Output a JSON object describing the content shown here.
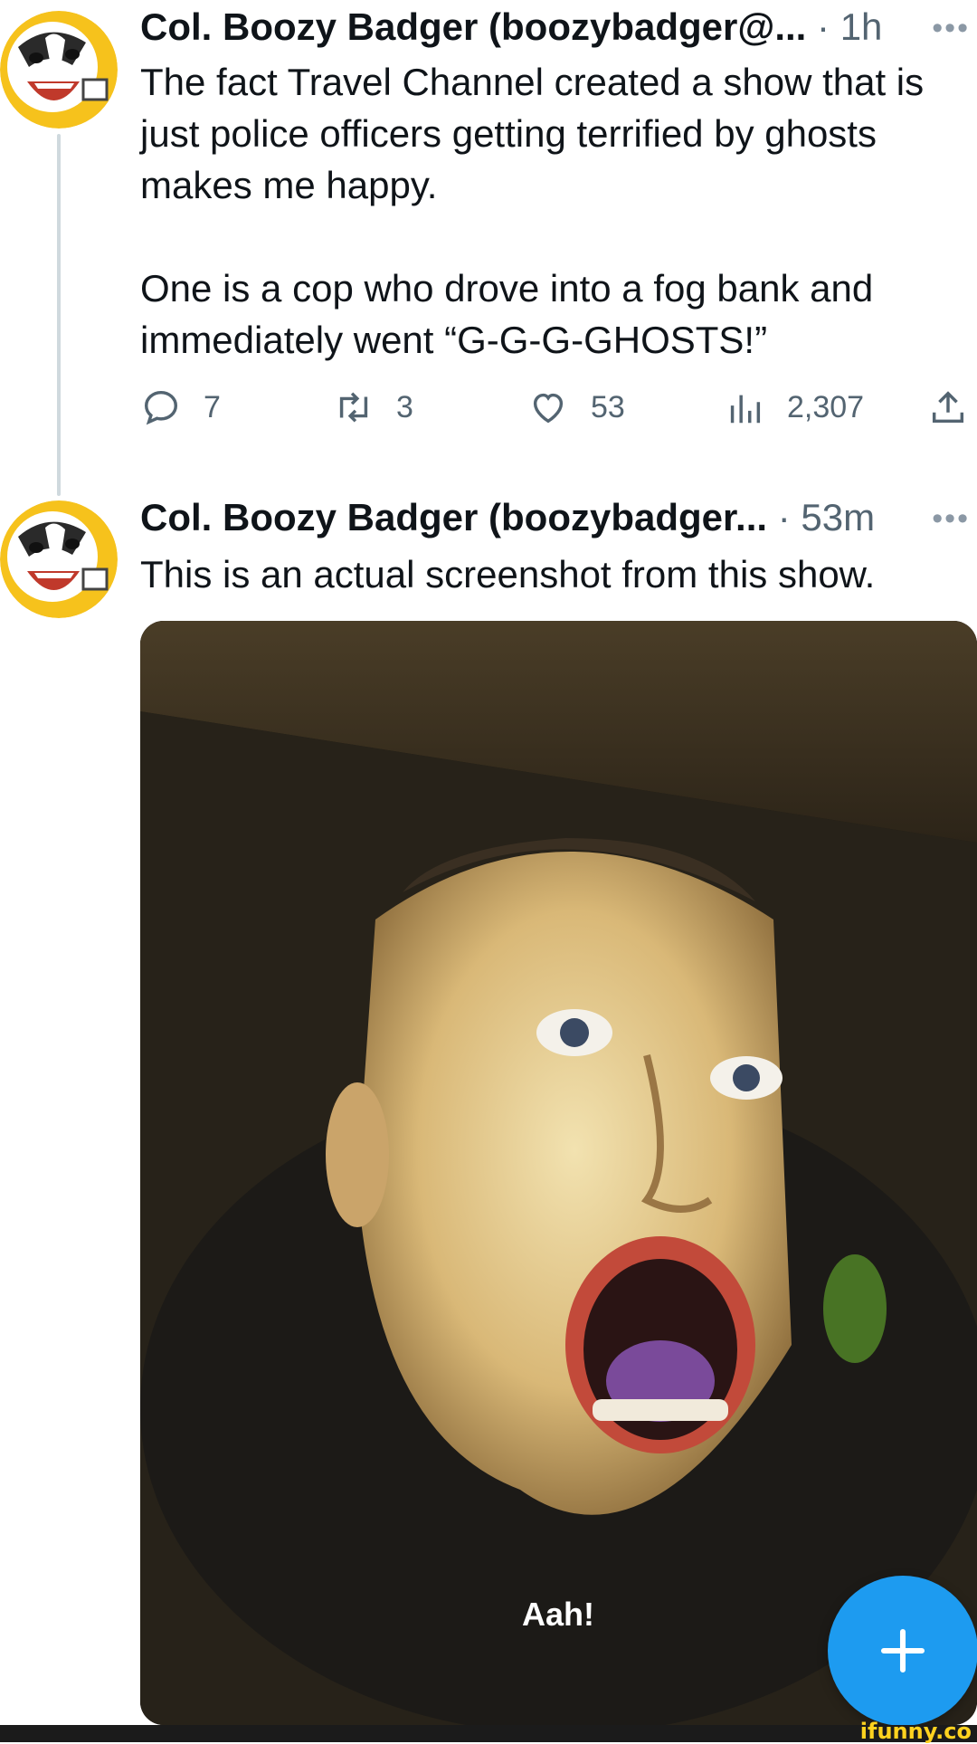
{
  "tweets": [
    {
      "name": "Col. Boozy Badger (boozybadger@...",
      "time": "1h",
      "text": "The fact Travel Channel created a show that is just police officers getting terrified by ghosts makes me happy.\n\nOne is a cop who drove into a fog bank and immediately went “G-G-G-GHOSTS!”",
      "replies": "7",
      "retweets": "3",
      "likes": "53",
      "views": "2,307"
    },
    {
      "name": "Col. Boozy Badger (boozybadger...",
      "time": "53m",
      "text": "This is an actual screenshot from this show.",
      "media_caption": "Aah!"
    }
  ],
  "separator": "·",
  "icons": {
    "more": "more-horizontal-icon",
    "reply": "reply-icon",
    "retweet": "retweet-icon",
    "like": "heart-icon",
    "views": "views-chart-icon",
    "share": "share-icon",
    "compose": "plus-icon"
  },
  "colors": {
    "accent": "#1d9bf0",
    "secondary_text": "#536471",
    "thread_line": "#cfd9de",
    "watermark": "#ffd21f"
  },
  "watermark": "ifunny.co"
}
